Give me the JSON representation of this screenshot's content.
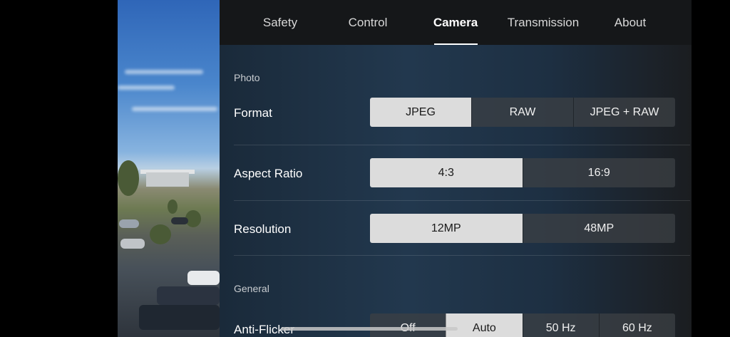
{
  "tabs": [
    {
      "label": "Safety"
    },
    {
      "label": "Control"
    },
    {
      "label": "Camera"
    },
    {
      "label": "Transmission"
    },
    {
      "label": "About"
    }
  ],
  "active_tab": "Camera",
  "sections": {
    "photo": {
      "label": "Photo"
    },
    "general": {
      "label": "General"
    }
  },
  "settings": {
    "format": {
      "label": "Format",
      "options": [
        "JPEG",
        "RAW",
        "JPEG + RAW"
      ],
      "selected": "JPEG"
    },
    "aspect_ratio": {
      "label": "Aspect Ratio",
      "options": [
        "4:3",
        "16:9"
      ],
      "selected": "4:3"
    },
    "resolution": {
      "label": "Resolution",
      "options": [
        "12MP",
        "48MP"
      ],
      "selected": "12MP"
    },
    "anti_flicker": {
      "label": "Anti-Flicker",
      "options": [
        "Off",
        "Auto",
        "50 Hz",
        "60 Hz"
      ],
      "selected": "Auto"
    }
  },
  "colors": {
    "selected_segment": "#dcdcdc",
    "unselected_segment": "#3c4044",
    "tab_bar": "#151719"
  }
}
